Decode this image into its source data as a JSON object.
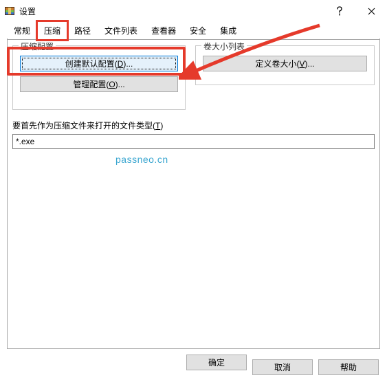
{
  "window": {
    "title": "设置"
  },
  "tabs": [
    {
      "label": "常规"
    },
    {
      "label": "压缩"
    },
    {
      "label": "路径"
    },
    {
      "label": "文件列表"
    },
    {
      "label": "查看器"
    },
    {
      "label": "安全"
    },
    {
      "label": "集成"
    }
  ],
  "groups": {
    "compress": {
      "title": "压缩配置",
      "create_btn": "创建默认配置(",
      "create_mn": "D",
      "create_suffix": ")...",
      "manage_btn": "管理配置(",
      "manage_mn": "O",
      "manage_suffix": ")..."
    },
    "volume": {
      "title": "卷大小列表",
      "define_btn": "定义卷大小(",
      "define_mn": "V",
      "define_suffix": ")..."
    }
  },
  "filetype": {
    "label_pre": "要首先作为压缩文件来打开的文件类型(",
    "label_mn": "T",
    "label_suf": ")",
    "value": "*.exe"
  },
  "watermark": "passneo.cn",
  "buttons": {
    "ok": "确定",
    "cancel": "取消",
    "help": "帮助"
  }
}
